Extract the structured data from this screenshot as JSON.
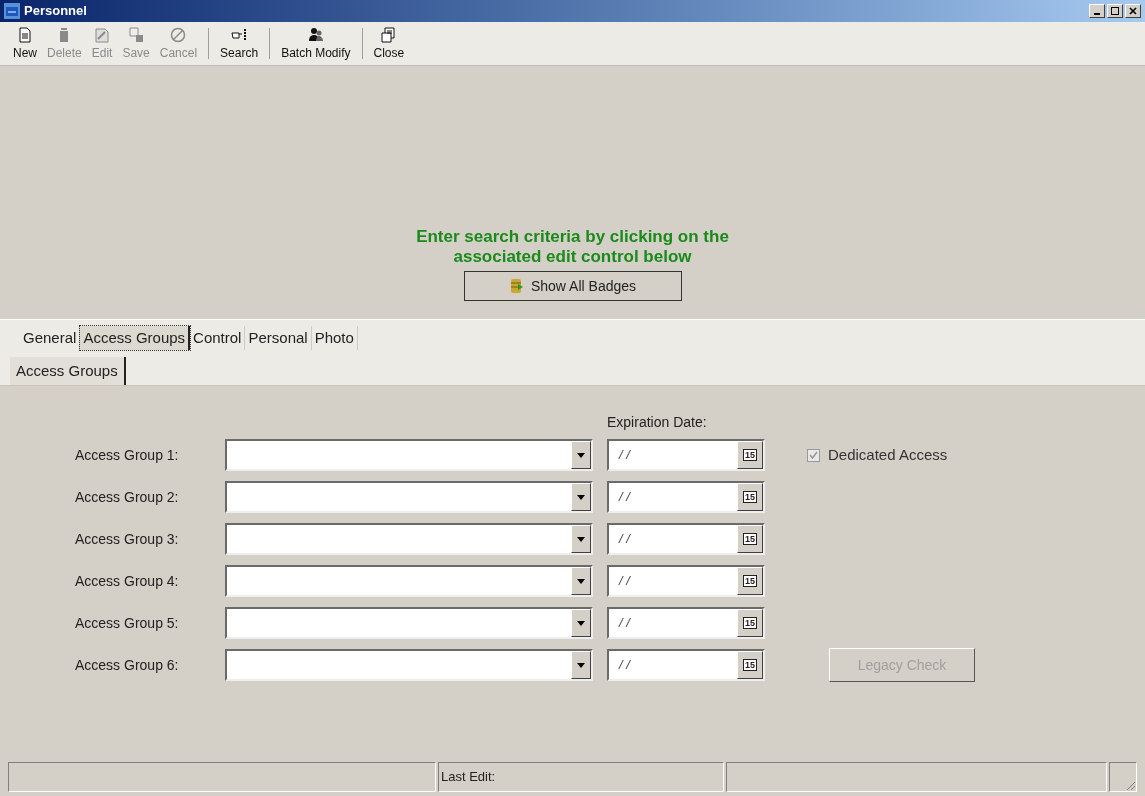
{
  "window": {
    "title": "Personnel"
  },
  "toolbar": [
    {
      "buttons": [
        {
          "label": "New",
          "disabled": false
        },
        {
          "label": "Delete",
          "disabled": true
        },
        {
          "label": "Edit",
          "disabled": true
        },
        {
          "label": "Save",
          "disabled": true
        },
        {
          "label": "Cancel",
          "disabled": true
        }
      ]
    },
    {
      "buttons": [
        {
          "label": "Search",
          "disabled": false
        }
      ]
    },
    {
      "buttons": [
        {
          "label": "Batch Modify",
          "disabled": false
        }
      ]
    },
    {
      "buttons": [
        {
          "label": "Close",
          "disabled": false
        }
      ]
    }
  ],
  "prompt": {
    "lines": [
      "Enter search criteria by clicking on the",
      "associated edit control below"
    ],
    "button": "Show All Badges"
  },
  "tabs": [
    {
      "label": "General",
      "selected": false
    },
    {
      "label": "Access Groups",
      "selected": true
    },
    {
      "label": "Control",
      "selected": false
    },
    {
      "label": "Personal",
      "selected": false
    },
    {
      "label": "Photo",
      "selected": false
    }
  ],
  "subtabs": [
    {
      "label": "Access Groups",
      "selected": true
    }
  ],
  "expiration_header": "Expiration Date:",
  "access_groups": [
    {
      "label": "Access Group 1:",
      "date": "/ /",
      "calendar": "15"
    },
    {
      "label": "Access Group 2:",
      "date": "/ /",
      "calendar": "15"
    },
    {
      "label": "Access Group 3:",
      "date": "/ /",
      "calendar": "15"
    },
    {
      "label": "Access Group 4:",
      "date": "/ /",
      "calendar": "15"
    },
    {
      "label": "Access Group 5:",
      "date": "/ /",
      "calendar": "15"
    },
    {
      "label": "Access Group 6:",
      "date": "/ /",
      "calendar": "15"
    }
  ],
  "dedicated_access": {
    "label": "Dedicated Access",
    "checked": true,
    "disabled": true
  },
  "legacy_check": {
    "label": "Legacy Check",
    "disabled": true
  },
  "status_bar": {
    "last_edit": "Last Edit:"
  }
}
